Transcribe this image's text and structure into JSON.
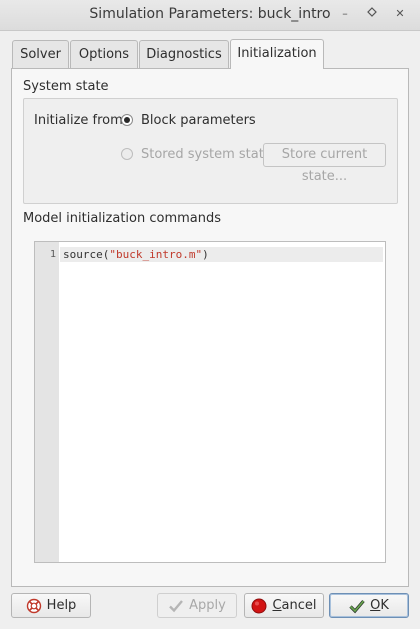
{
  "window": {
    "title": "Simulation Parameters: buck_intro",
    "controls": {
      "minimize": "–",
      "maximize": "◆",
      "close": "✕"
    }
  },
  "tabs": [
    {
      "label": "Solver",
      "active": false
    },
    {
      "label": "Options",
      "active": false
    },
    {
      "label": "Diagnostics",
      "active": false
    },
    {
      "label": "Initialization",
      "active": true
    }
  ],
  "system_state": {
    "section_label": "System state",
    "initialize_from_label": "Initialize from:",
    "options": [
      {
        "label": "Block parameters",
        "checked": true,
        "enabled": true
      },
      {
        "label": "Stored system state",
        "checked": false,
        "enabled": false
      }
    ],
    "store_button_label": "Store current state..."
  },
  "commands": {
    "section_label": "Model initialization commands",
    "lines": [
      {
        "number": "1",
        "prefix": "source(",
        "string": "\"buck_intro.m\"",
        "suffix": ")"
      }
    ]
  },
  "buttons": {
    "help": {
      "label": "Help",
      "icon": "help-lifebuoy-icon"
    },
    "apply": {
      "label": "Apply",
      "icon": "checkmark-icon",
      "enabled": false
    },
    "cancel": {
      "prefix": "",
      "mnemonic": "C",
      "rest": "ancel",
      "icon": "stop-circle-icon"
    },
    "ok": {
      "mnemonic": "O",
      "rest": "K",
      "icon": "checkmark-icon",
      "default": true
    }
  },
  "colors": {
    "string_literal": "#c0392b",
    "cancel_icon": "#d21414",
    "help_icon": "#c0392b"
  }
}
